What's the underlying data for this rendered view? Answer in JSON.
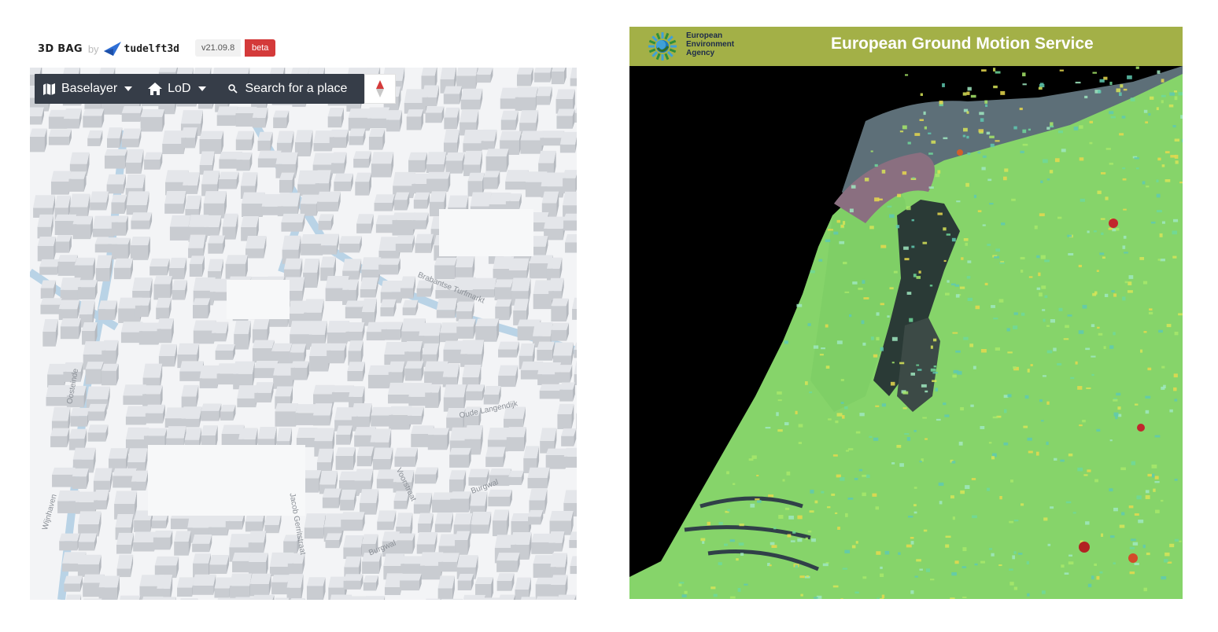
{
  "bag": {
    "title": "3D BAG",
    "by": "by",
    "org": "tudelft3d",
    "version": "v21.09.8",
    "badge": "beta",
    "toolbar": {
      "baselayer_label": "Baselayer",
      "lod_label": "LoD",
      "search_placeholder": "Search for a place"
    },
    "icons": [
      "map-icon",
      "chevron-down-icon",
      "home-icon",
      "search-icon",
      "compass-icon"
    ],
    "streets": [
      "Oude Langendijk",
      "Burgwal",
      "Burgwal",
      "Jacob Gerritstraat",
      "Voorstraat",
      "Wijnhaven",
      "Oosteinde",
      "Brabantse Turfmarkt"
    ]
  },
  "egms": {
    "agency_line1": "European",
    "agency_line2": "Environment",
    "agency_line3": "Agency",
    "title": "European Ground Motion Service",
    "colors": {
      "header": "#a3b047",
      "sea": "#000000",
      "land": "#8ee06b"
    }
  }
}
